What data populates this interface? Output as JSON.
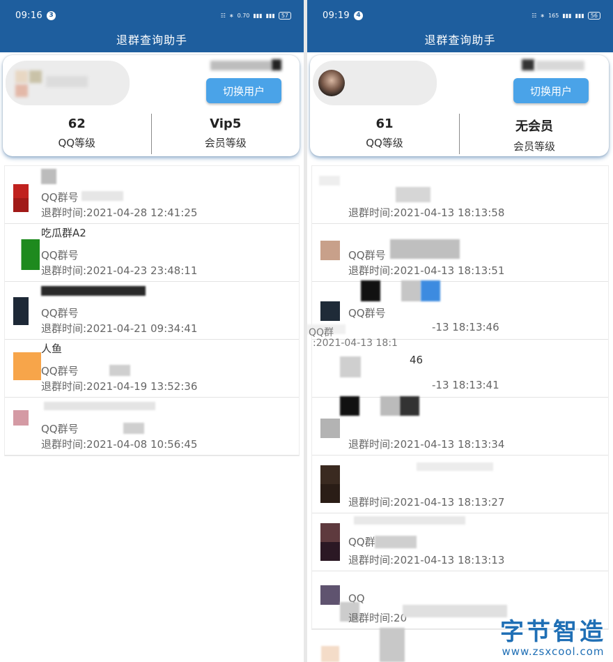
{
  "colors": {
    "appbar": "#1e5e9e",
    "button": "#4aa3e8",
    "watermark": "#1f6fb5"
  },
  "left": {
    "status": {
      "time": "09:16",
      "notif": "3",
      "net": "0.70",
      "battery": "57"
    },
    "title": "退群查询助手",
    "switch_label": "切换用户",
    "qq_level": "62",
    "qq_level_label": "QQ等级",
    "vip_level": "Vip5",
    "vip_level_label": "会员等级",
    "groups": [
      {
        "name": "",
        "gid_label": "QQ群号",
        "time": "退群时间:2021-04-28 12:41:25"
      },
      {
        "name": "吃瓜群A2",
        "gid_label": "QQ群号",
        "time": "退群时间:2021-04-23 23:48:11"
      },
      {
        "name": "",
        "gid_label": "QQ群号",
        "time": "退群时间:2021-04-21 09:34:41"
      },
      {
        "name": "人鱼",
        "gid_label": "QQ群号",
        "time": "退群时间:2021-04-19 13:52:36"
      },
      {
        "name": "",
        "gid_label": "QQ群号",
        "time": "退群时间:2021-04-08 10:56:45"
      }
    ]
  },
  "right": {
    "status": {
      "time": "09:19",
      "notif": "4",
      "net": "165",
      "battery": "56"
    },
    "title": "退群查询助手",
    "switch_label": "切换用户",
    "qq_level": "61",
    "qq_level_label": "QQ等级",
    "vip_level": "无会员",
    "vip_level_label": "会员等级",
    "groups": [
      {
        "name": "",
        "gid_label": "",
        "time": "退群时间:2021-04-13 18:13:58"
      },
      {
        "name": "",
        "gid_label": "QQ群号",
        "time": "退群时间:2021-04-13 18:13:51"
      },
      {
        "name": "",
        "gid_label": "QQ群号",
        "time": "-13 18:13:46"
      },
      {
        "name": "46",
        "gid_label": "",
        "time": "-13 18:13:41"
      },
      {
        "name": "",
        "gid_label": "",
        "time": "退群时间:2021-04-13 18:13:34"
      },
      {
        "name": "",
        "gid_label": "",
        "time": "退群时间:2021-04-13 18:13:27"
      },
      {
        "name": "",
        "gid_label": "QQ群",
        "time": "退群时间:2021-04-13 18:13:13"
      },
      {
        "name": "",
        "gid_label": "QQ",
        "time": "退群时间:20"
      }
    ],
    "overlay_snippet": {
      "gid": "QQ群",
      "time": ":2021-04-13 18:1"
    }
  },
  "watermark": {
    "main": "字节智造",
    "url": "www.zsxcool.com"
  }
}
